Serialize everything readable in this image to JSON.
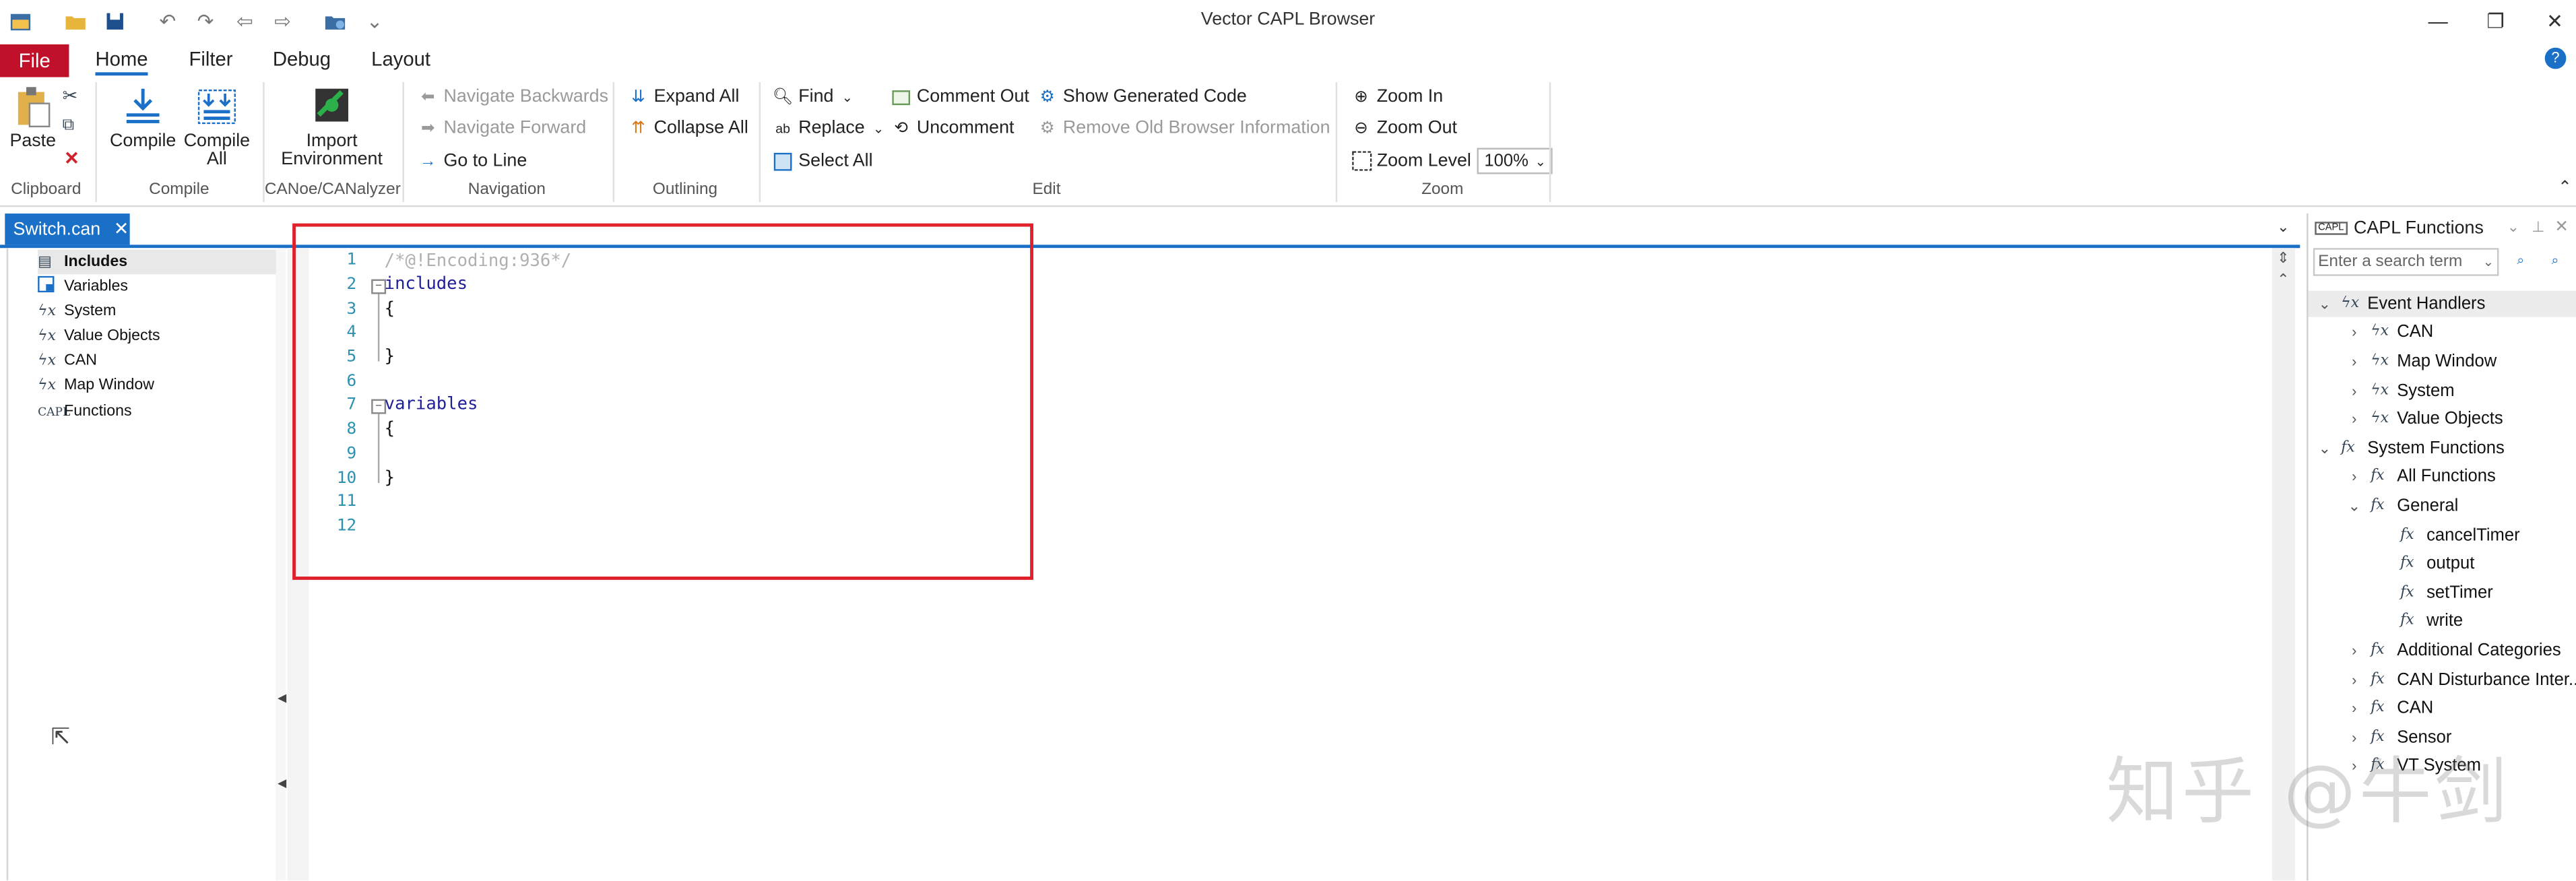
{
  "window": {
    "title": "Vector CAPL Browser",
    "min_glyph": "—",
    "restore_glyph": "❐",
    "close_glyph": "✕"
  },
  "ribbon_tabs": {
    "file": "File",
    "home": "Home",
    "filter": "Filter",
    "debug": "Debug",
    "layout": "Layout"
  },
  "clipboard": {
    "paste": "Paste",
    "group": "Clipboard"
  },
  "compile": {
    "compile": "Compile",
    "compile_all_1": "Compile",
    "compile_all_2": "All",
    "group": "Compile"
  },
  "canoe": {
    "import_1": "Import",
    "import_2": "Environment",
    "group": "CANoe/CANalyzer"
  },
  "navigation": {
    "back": "Navigate Backwards",
    "forward": "Navigate Forward",
    "goto": "Go to Line",
    "group": "Navigation"
  },
  "outlining": {
    "expand": "Expand All",
    "collapse": "Collapse All",
    "group": "Outlining"
  },
  "edit": {
    "find": "Find",
    "replace": "Replace",
    "select_all": "Select All",
    "comment": "Comment Out",
    "uncomment": "Uncomment",
    "show_generated": "Show Generated Code",
    "remove_old": "Remove Old Browser Information",
    "group": "Edit"
  },
  "zoom": {
    "zoom_in": "Zoom In",
    "zoom_out": "Zoom Out",
    "zoom_level": "Zoom Level",
    "level_value": "100%",
    "group": "Zoom"
  },
  "document_tab": {
    "label": "Switch.can"
  },
  "outline": {
    "items": [
      {
        "label": "Includes",
        "icon": "includes-icon"
      },
      {
        "label": "Variables",
        "icon": "variables-icon"
      },
      {
        "label": "System",
        "icon": "event-handler-icon"
      },
      {
        "label": "Value Objects",
        "icon": "event-handler-icon"
      },
      {
        "label": "CAN",
        "icon": "event-handler-icon"
      },
      {
        "label": "Map Window",
        "icon": "event-handler-icon"
      },
      {
        "label": "Functions",
        "icon": "capl-functions-icon"
      }
    ]
  },
  "editor": {
    "line_numbers": [
      "1",
      "2",
      "3",
      "4",
      "5",
      "6",
      "7",
      "8",
      "9",
      "10",
      "11",
      "12"
    ],
    "lines": {
      "l1": "/*@!Encoding:936*/",
      "l2": "includes",
      "l3": "{",
      "l5": "}",
      "l7": "variables",
      "l8": "{",
      "l10": "}"
    }
  },
  "capl_pane": {
    "title": "CAPL Functions",
    "search_placeholder": "Enter a search term",
    "tree": {
      "event_handlers": "Event Handlers",
      "eh_can": "CAN",
      "eh_map": "Map Window",
      "eh_system": "System",
      "eh_value": "Value Objects",
      "system_functions": "System Functions",
      "all_functions": "All Functions",
      "general": "General",
      "cancel_timer": "cancelTimer",
      "output": "output",
      "set_timer": "setTimer",
      "write": "write",
      "additional": "Additional Categories",
      "can_disturbance": "CAN Disturbance Inter...",
      "sf_can": "CAN",
      "sensor": "Sensor",
      "vt_system": "VT System"
    }
  },
  "watermark": "知乎 @牛剑"
}
